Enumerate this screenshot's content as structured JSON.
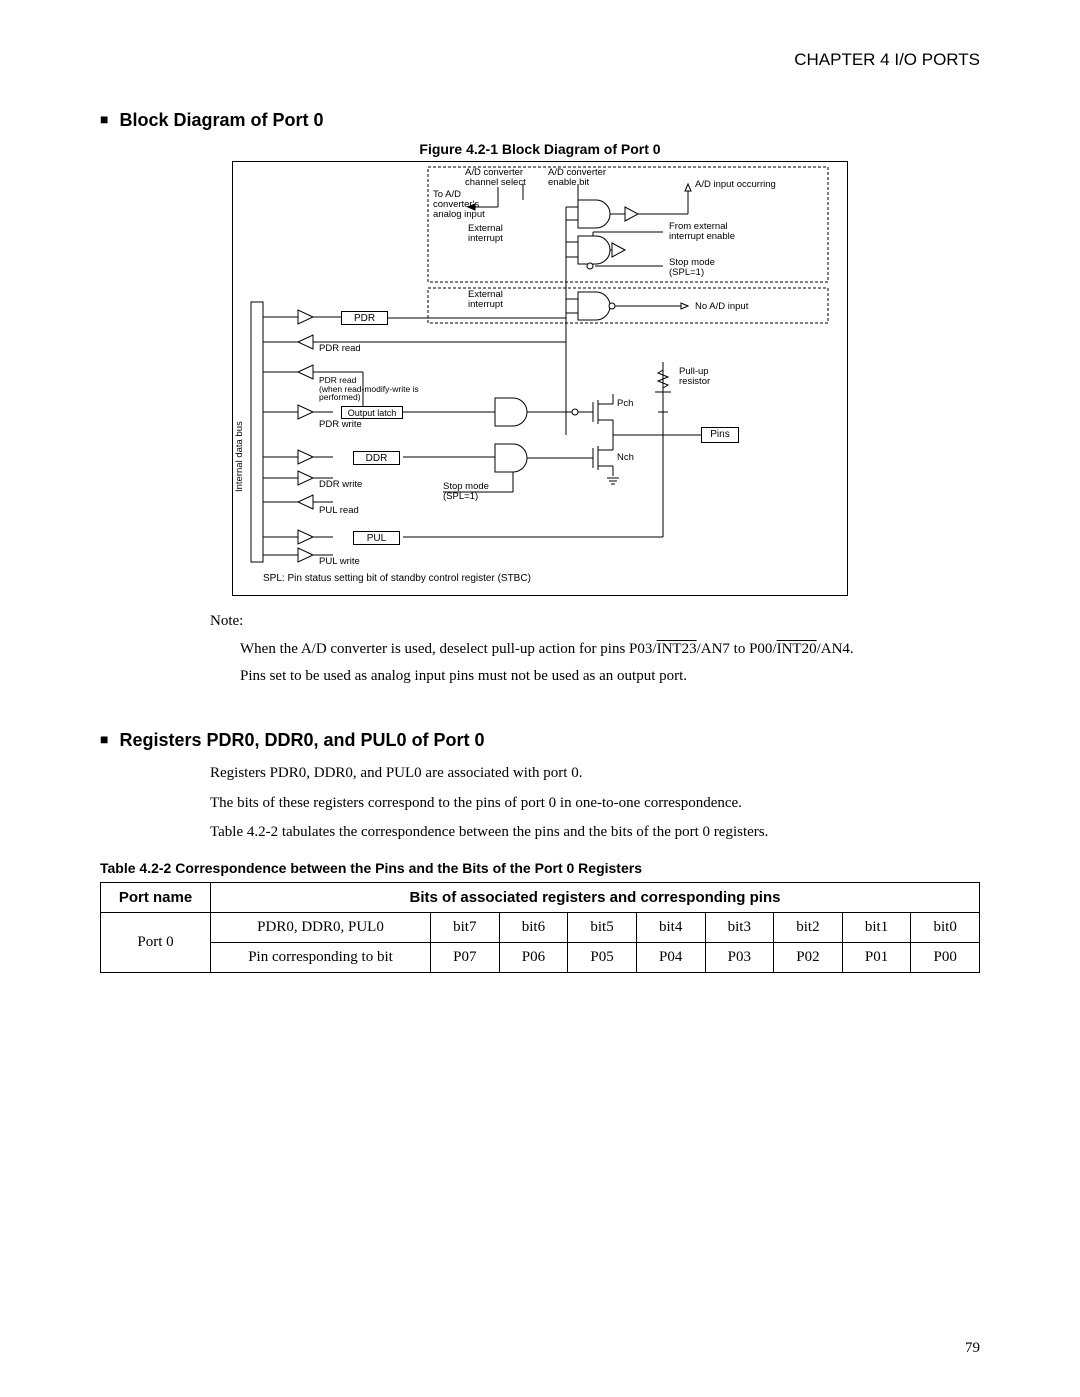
{
  "chapter": "CHAPTER 4  I/O PORTS",
  "section1": {
    "title": "Block Diagram of Port 0"
  },
  "figure": {
    "caption": "Figure 4.2-1  Block Diagram of Port 0"
  },
  "diagram": {
    "internal_data_bus": "Internal data bus",
    "ad_converter_channel_select": "A/D converter\nchannel select",
    "ad_converter_enable_bit": "A/D converter\nenable bit",
    "ad_input_occurring": "A/D input occurring",
    "to_ad_converters_analog_input": "To A/D\nconverter's\nanalog input",
    "external_interrupt": "External\ninterrupt",
    "from_external_interrupt_enable": "From external\ninterrupt enable",
    "stop_mode_spl1_a": "Stop mode\n(SPL=1)",
    "no_ad_input": "No A/D input",
    "pdr": "PDR",
    "pdr_read": "PDR read",
    "pdr_read_rmw": "PDR read\n(when read-modify-write is\nperformed)",
    "output_latch": "Output latch",
    "pdr_write": "PDR write",
    "ddr": "DDR",
    "ddr_write": "DDR write",
    "stop_mode_spl1_b": "Stop mode\n(SPL=1)",
    "pul_read": "PUL read",
    "pul": "PUL",
    "pul_write": "PUL write",
    "pch": "Pch",
    "nch": "Nch",
    "pull_up_resistor": "Pull-up\nresistor",
    "pins": "Pins",
    "spl_note": "SPL:  Pin status setting bit of standby control register (STBC)"
  },
  "note": {
    "label": "Note:",
    "line1_prefix": "When the A/D converter is used, deselect pull-up action for pins P03/",
    "line1_int23": "INT23",
    "line1_mid": "/AN7 to P00/",
    "line1_int20": "INT20",
    "line1_suffix": "/AN4.",
    "line2": "Pins set to be used as analog input pins must not be used as an output port."
  },
  "section2": {
    "title": "Registers PDR0, DDR0, and PUL0 of Port 0",
    "p1": "Registers PDR0, DDR0, and PUL0 are associated with port 0.",
    "p2": "The bits of these registers correspond to the pins of port 0 in one-to-one correspondence.",
    "p3": "Table 4.2-2  tabulates the correspondence between the pins and the bits of the port 0 registers."
  },
  "table": {
    "caption": "Table 4.2-2  Correspondence between the Pins and the Bits of the Port 0 Registers",
    "port_name_header": "Port name",
    "bits_header": "Bits of associated registers and corresponding pins",
    "port_name": "Port 0",
    "row1_label": "PDR0, DDR0, PUL0",
    "row2_label": "Pin corresponding to bit",
    "bits": [
      "bit7",
      "bit6",
      "bit5",
      "bit4",
      "bit3",
      "bit2",
      "bit1",
      "bit0"
    ],
    "pins": [
      "P07",
      "P06",
      "P05",
      "P04",
      "P03",
      "P02",
      "P01",
      "P00"
    ]
  },
  "page_number": "79"
}
